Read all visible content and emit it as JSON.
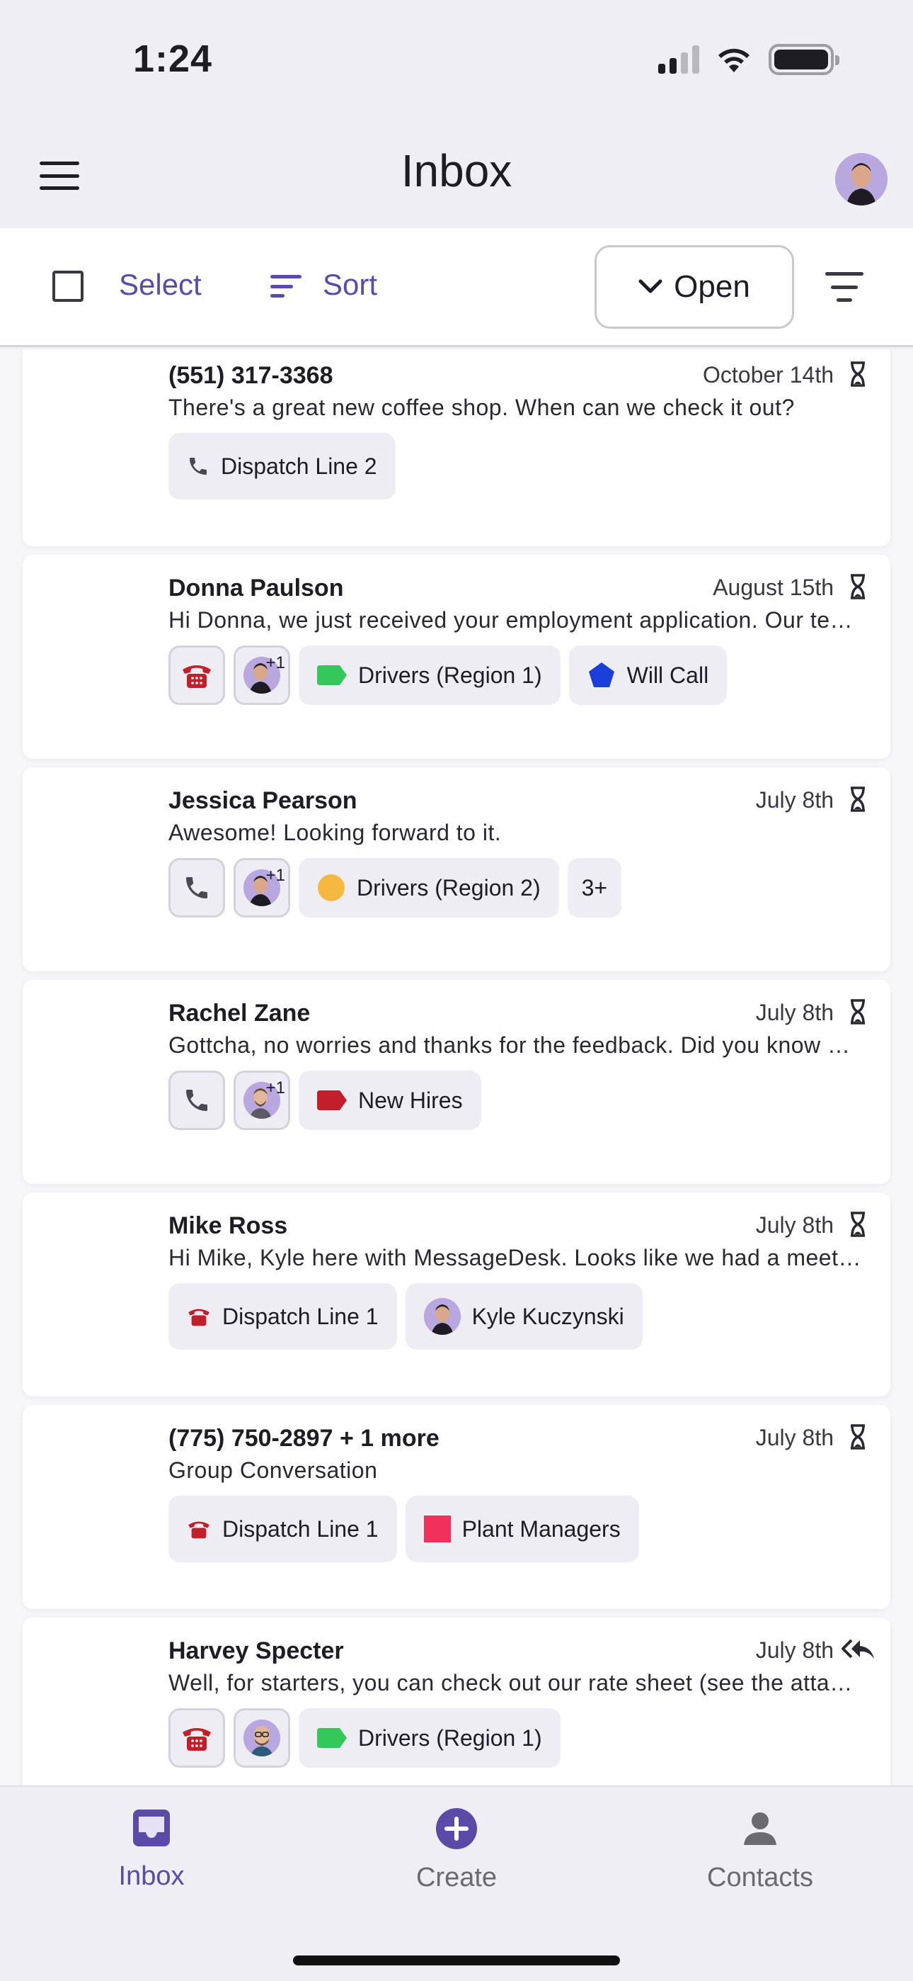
{
  "status_bar": {
    "time": "1:24"
  },
  "header": {
    "title": "Inbox"
  },
  "toolbar": {
    "select_label": "Select",
    "sort_label": "Sort",
    "status_filter": "Open"
  },
  "conversations": [
    {
      "name": "(551) 317-3368",
      "date": "October 14th",
      "preview": "There's a great new coffee shop. When can we check it out?",
      "status_icon": "hourglass-icon",
      "line_chip": "Dispatch Line 2"
    },
    {
      "name": "Donna Paulson",
      "date": "August 15th",
      "preview": "Hi Donna, we just received your employment application. Our team is reviewing it now.",
      "status_icon": "hourglass-icon",
      "assignee_extra": "+1",
      "tags": [
        "Drivers (Region 1)",
        "Will Call"
      ]
    },
    {
      "name": "Jessica Pearson",
      "date": "July 8th",
      "preview": "Awesome! Looking forward to it.",
      "status_icon": "hourglass-icon",
      "assignee_extra": "+1",
      "tags": [
        "Drivers (Region 2)"
      ],
      "more_tags": "3+"
    },
    {
      "name": "Rachel Zane",
      "date": "July 8th",
      "preview": "Gottcha, no worries and thanks for the feedback. Did you know we can help with that too?",
      "status_icon": "hourglass-icon",
      "assignee_extra": "+1",
      "tags": [
        "New Hires"
      ]
    },
    {
      "name": "Mike Ross",
      "date": "July 8th",
      "preview": "Hi Mike, Kyle here with MessageDesk. Looks like we had a meeting scheduled for today.",
      "status_icon": "hourglass-icon",
      "line_chip": "Dispatch Line 1",
      "assignee": "Kyle Kuczynski"
    },
    {
      "name": "(775) 750-2897 + 1 more",
      "date": "July 8th",
      "preview": "Group Conversation",
      "status_icon": "hourglass-icon",
      "line_chip": "Dispatch Line 1",
      "tags": [
        "Plant Managers"
      ]
    },
    {
      "name": "Harvey Specter",
      "date": "July 8th",
      "preview": "Well, for starters, you can check out our rate sheet (see the attached file).",
      "status_icon": "reply-all-icon",
      "tags": [
        "Drivers (Region 1)"
      ]
    }
  ],
  "tab_bar": {
    "inbox": "Inbox",
    "create": "Create",
    "contacts": "Contacts"
  },
  "colors": {
    "accent": "#5b4aa8",
    "tag_green": "#34c759",
    "tag_blue": "#1a3fd6",
    "tag_yellow": "#f5b942",
    "tag_red": "#c21f2b",
    "tag_pink": "#f0315a"
  }
}
